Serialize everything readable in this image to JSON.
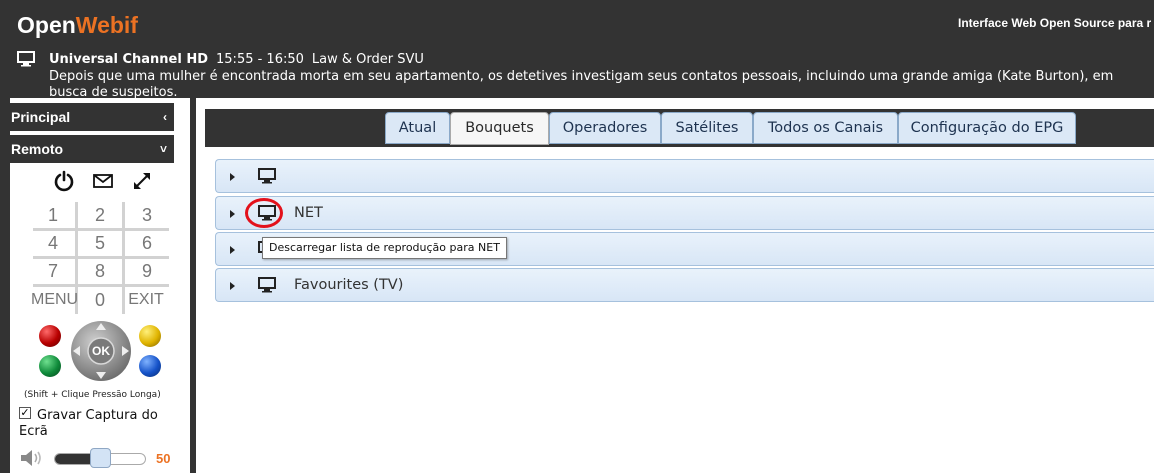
{
  "header": {
    "logo_open": "Open",
    "logo_webif": "Webif",
    "tagline": "Interface Web Open Source para r",
    "now": {
      "channel": "Universal Channel HD",
      "time": "15:55 - 16:50",
      "title": "Law & Order SVU",
      "description": "Depois que uma mulher é encontrada morta em seu apartamento, os detetives investigam seus contatos pessoais, incluindo uma grande amiga (Kate Burton), em busca de suspeitos."
    }
  },
  "sidebar": {
    "principal_label": "Principal",
    "principal_chevron": "‹",
    "remoto_label": "Remoto",
    "remoto_chevron": "˅",
    "keys": [
      "1",
      "2",
      "3",
      "4",
      "5",
      "6",
      "7",
      "8",
      "9",
      "MENU",
      "0",
      "EXIT"
    ],
    "ok_label": "OK",
    "hint": "(Shift + Clique Pressão Longa)",
    "capture_check": "✓",
    "capture_label": "Gravar Captura do",
    "capture_label2": "Ecrã",
    "volume_fraction": 0.5,
    "volume_value": "50",
    "ball_colors": {
      "red": "#b80000",
      "green": "#0f8a3a",
      "yellow": "#e0b400",
      "blue": "#1552c8"
    }
  },
  "tabs": [
    {
      "label": "Atual",
      "active": false
    },
    {
      "label": "Bouquets",
      "active": true
    },
    {
      "label": "Operadores",
      "active": false
    },
    {
      "label": "Satélites",
      "active": false
    },
    {
      "label": "Todos os Canais",
      "active": false
    },
    {
      "label": "Configuração do EPG",
      "active": false
    }
  ],
  "bouquets": [
    {
      "label": ""
    },
    {
      "label": "NET"
    },
    {
      "label": ""
    },
    {
      "label": "Favourites (TV)"
    }
  ],
  "tooltip": "Descarregar lista de reprodução para NET",
  "colors": {
    "accent": "#ec7223",
    "annotation": "#e3111b"
  }
}
